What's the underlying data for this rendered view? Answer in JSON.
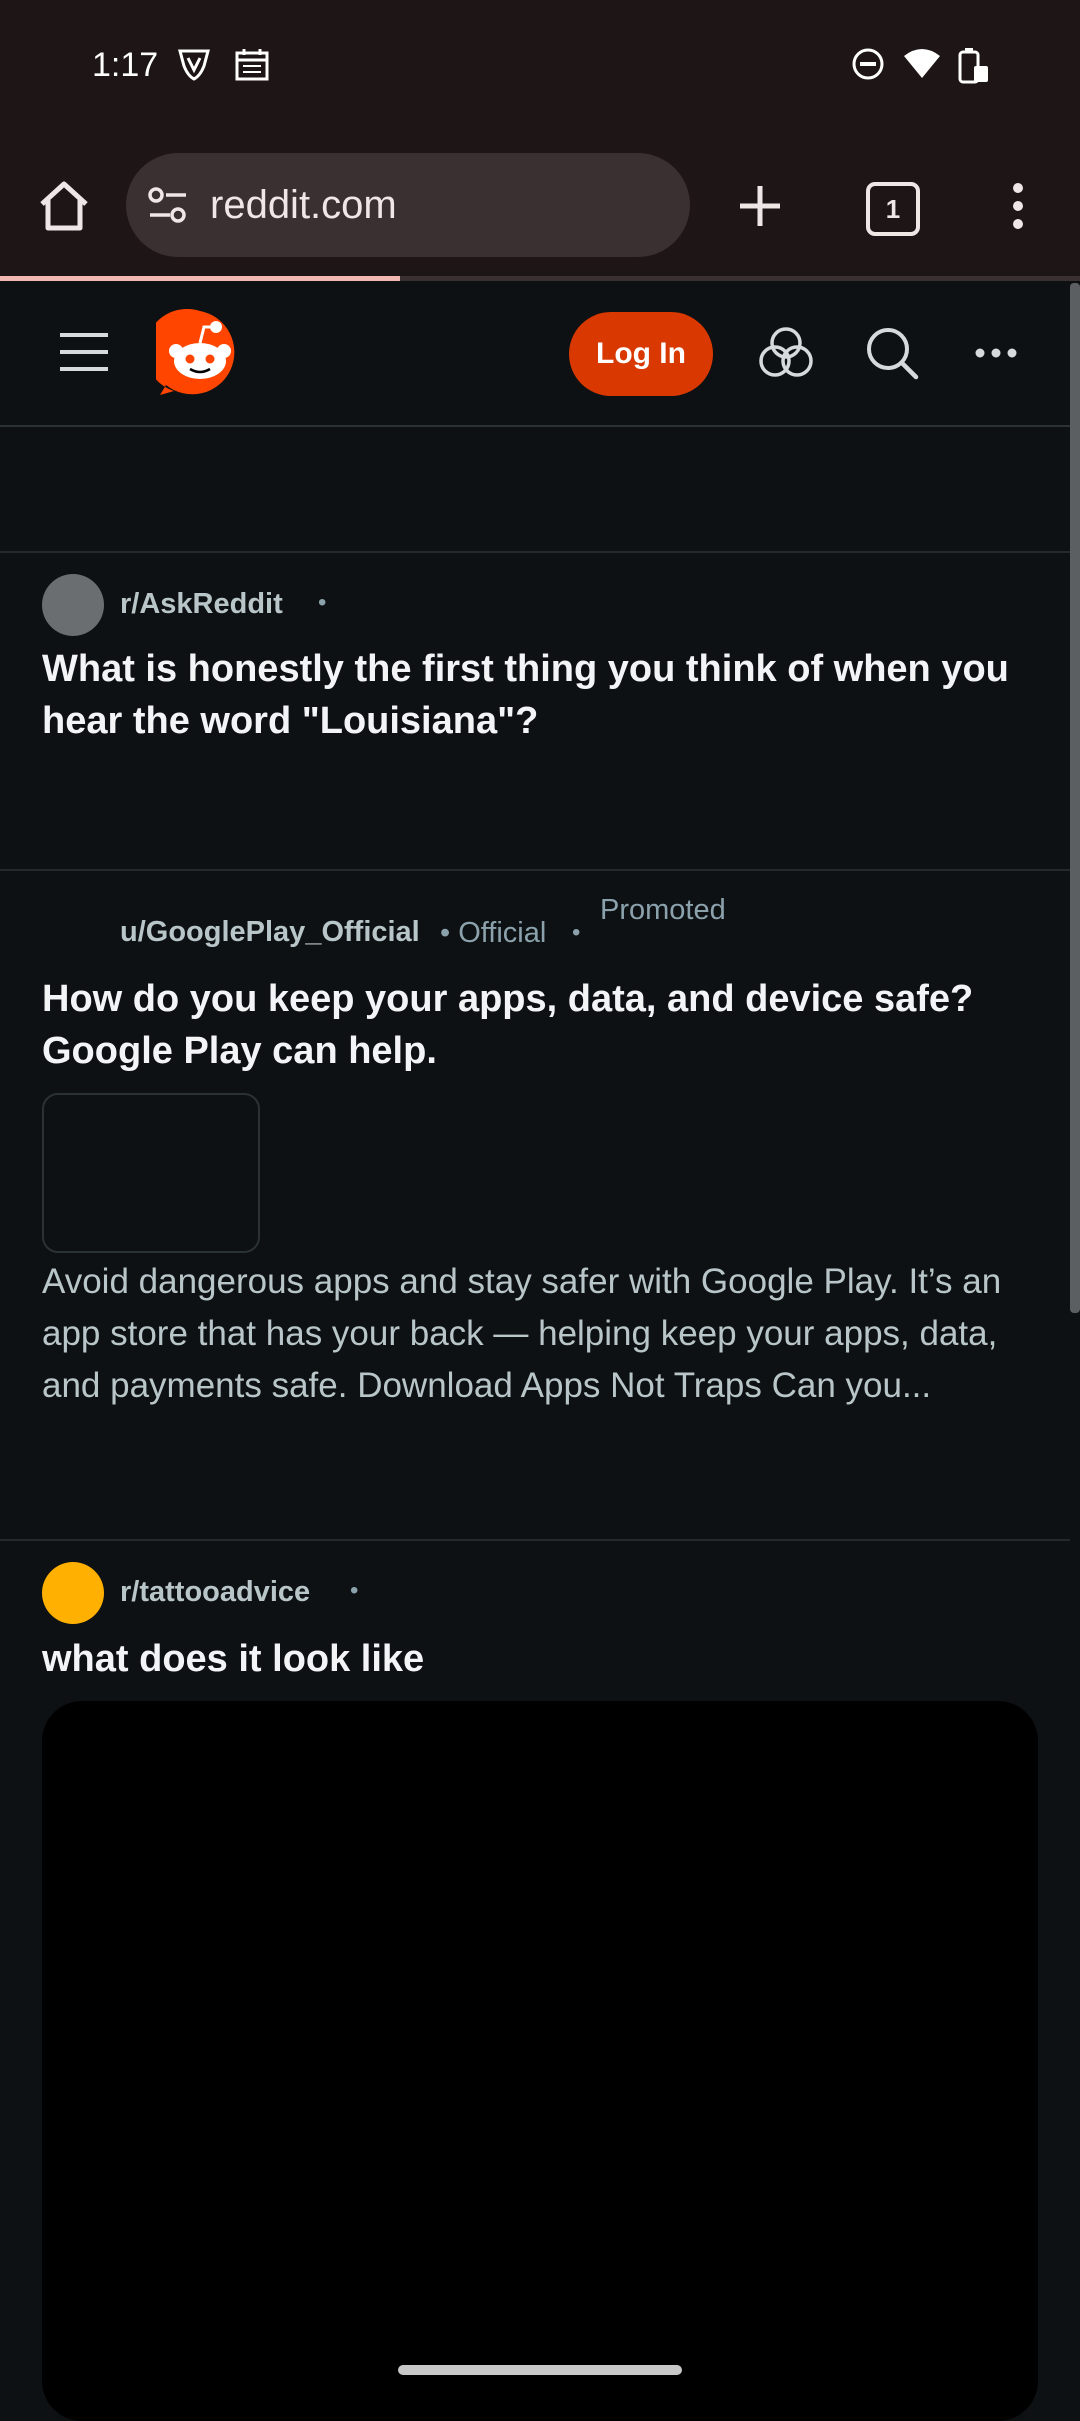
{
  "status": {
    "time": "1:17"
  },
  "browser": {
    "url": "reddit.com",
    "tab_count": "1",
    "load_progress": 0.37
  },
  "reddit_header": {
    "login_label": "Log In"
  },
  "colors": {
    "login": "#d93900",
    "reddit_logo": "#ff4500",
    "askreddit_avatar": "#6b6e70",
    "tattooadvice_avatar": "#ffb000"
  },
  "posts": [
    {
      "community": "r/AskReddit",
      "separator": "•",
      "title": "What is honestly the first thing you think of when you hear the word \"Louisiana\"?"
    },
    {
      "author": "u/GooglePlay_Official",
      "official": "• Official",
      "separator": "•",
      "promoted": "Promoted",
      "title": "How do you keep your apps, data, and device safe? Google Play can help.",
      "body": "Avoid dangerous apps and stay safer with Google Play. It’s an app store that has your back — helping keep your apps, data, and payments safe. Download Apps Not Traps Can you..."
    },
    {
      "community": "r/tattooadvice",
      "separator": "•",
      "title": "what does it look like"
    }
  ]
}
